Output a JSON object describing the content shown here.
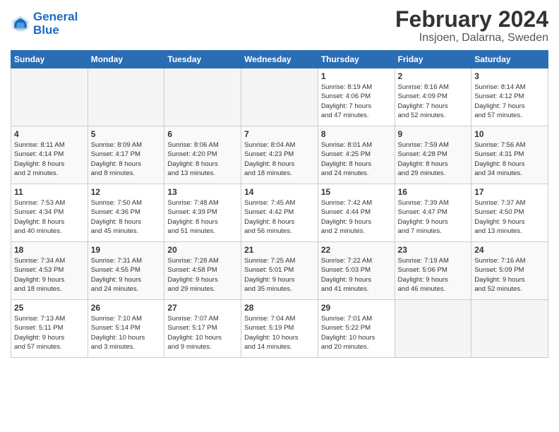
{
  "header": {
    "logo_line1": "General",
    "logo_line2": "Blue",
    "title": "February 2024",
    "subtitle": "Insjoen, Dalarna, Sweden"
  },
  "weekdays": [
    "Sunday",
    "Monday",
    "Tuesday",
    "Wednesday",
    "Thursday",
    "Friday",
    "Saturday"
  ],
  "weeks": [
    [
      {
        "day": "",
        "info": ""
      },
      {
        "day": "",
        "info": ""
      },
      {
        "day": "",
        "info": ""
      },
      {
        "day": "",
        "info": ""
      },
      {
        "day": "1",
        "info": "Sunrise: 8:19 AM\nSunset: 4:06 PM\nDaylight: 7 hours\nand 47 minutes."
      },
      {
        "day": "2",
        "info": "Sunrise: 8:16 AM\nSunset: 4:09 PM\nDaylight: 7 hours\nand 52 minutes."
      },
      {
        "day": "3",
        "info": "Sunrise: 8:14 AM\nSunset: 4:12 PM\nDaylight: 7 hours\nand 57 minutes."
      }
    ],
    [
      {
        "day": "4",
        "info": "Sunrise: 8:11 AM\nSunset: 4:14 PM\nDaylight: 8 hours\nand 2 minutes."
      },
      {
        "day": "5",
        "info": "Sunrise: 8:09 AM\nSunset: 4:17 PM\nDaylight: 8 hours\nand 8 minutes."
      },
      {
        "day": "6",
        "info": "Sunrise: 8:06 AM\nSunset: 4:20 PM\nDaylight: 8 hours\nand 13 minutes."
      },
      {
        "day": "7",
        "info": "Sunrise: 8:04 AM\nSunset: 4:23 PM\nDaylight: 8 hours\nand 18 minutes."
      },
      {
        "day": "8",
        "info": "Sunrise: 8:01 AM\nSunset: 4:25 PM\nDaylight: 8 hours\nand 24 minutes."
      },
      {
        "day": "9",
        "info": "Sunrise: 7:59 AM\nSunset: 4:28 PM\nDaylight: 8 hours\nand 29 minutes."
      },
      {
        "day": "10",
        "info": "Sunrise: 7:56 AM\nSunset: 4:31 PM\nDaylight: 8 hours\nand 34 minutes."
      }
    ],
    [
      {
        "day": "11",
        "info": "Sunrise: 7:53 AM\nSunset: 4:34 PM\nDaylight: 8 hours\nand 40 minutes."
      },
      {
        "day": "12",
        "info": "Sunrise: 7:50 AM\nSunset: 4:36 PM\nDaylight: 8 hours\nand 45 minutes."
      },
      {
        "day": "13",
        "info": "Sunrise: 7:48 AM\nSunset: 4:39 PM\nDaylight: 8 hours\nand 51 minutes."
      },
      {
        "day": "14",
        "info": "Sunrise: 7:45 AM\nSunset: 4:42 PM\nDaylight: 8 hours\nand 56 minutes."
      },
      {
        "day": "15",
        "info": "Sunrise: 7:42 AM\nSunset: 4:44 PM\nDaylight: 9 hours\nand 2 minutes."
      },
      {
        "day": "16",
        "info": "Sunrise: 7:39 AM\nSunset: 4:47 PM\nDaylight: 9 hours\nand 7 minutes."
      },
      {
        "day": "17",
        "info": "Sunrise: 7:37 AM\nSunset: 4:50 PM\nDaylight: 9 hours\nand 13 minutes."
      }
    ],
    [
      {
        "day": "18",
        "info": "Sunrise: 7:34 AM\nSunset: 4:53 PM\nDaylight: 9 hours\nand 18 minutes."
      },
      {
        "day": "19",
        "info": "Sunrise: 7:31 AM\nSunset: 4:55 PM\nDaylight: 9 hours\nand 24 minutes."
      },
      {
        "day": "20",
        "info": "Sunrise: 7:28 AM\nSunset: 4:58 PM\nDaylight: 9 hours\nand 29 minutes."
      },
      {
        "day": "21",
        "info": "Sunrise: 7:25 AM\nSunset: 5:01 PM\nDaylight: 9 hours\nand 35 minutes."
      },
      {
        "day": "22",
        "info": "Sunrise: 7:22 AM\nSunset: 5:03 PM\nDaylight: 9 hours\nand 41 minutes."
      },
      {
        "day": "23",
        "info": "Sunrise: 7:19 AM\nSunset: 5:06 PM\nDaylight: 9 hours\nand 46 minutes."
      },
      {
        "day": "24",
        "info": "Sunrise: 7:16 AM\nSunset: 5:09 PM\nDaylight: 9 hours\nand 52 minutes."
      }
    ],
    [
      {
        "day": "25",
        "info": "Sunrise: 7:13 AM\nSunset: 5:11 PM\nDaylight: 9 hours\nand 57 minutes."
      },
      {
        "day": "26",
        "info": "Sunrise: 7:10 AM\nSunset: 5:14 PM\nDaylight: 10 hours\nand 3 minutes."
      },
      {
        "day": "27",
        "info": "Sunrise: 7:07 AM\nSunset: 5:17 PM\nDaylight: 10 hours\nand 9 minutes."
      },
      {
        "day": "28",
        "info": "Sunrise: 7:04 AM\nSunset: 5:19 PM\nDaylight: 10 hours\nand 14 minutes."
      },
      {
        "day": "29",
        "info": "Sunrise: 7:01 AM\nSunset: 5:22 PM\nDaylight: 10 hours\nand 20 minutes."
      },
      {
        "day": "",
        "info": ""
      },
      {
        "day": "",
        "info": ""
      }
    ]
  ]
}
